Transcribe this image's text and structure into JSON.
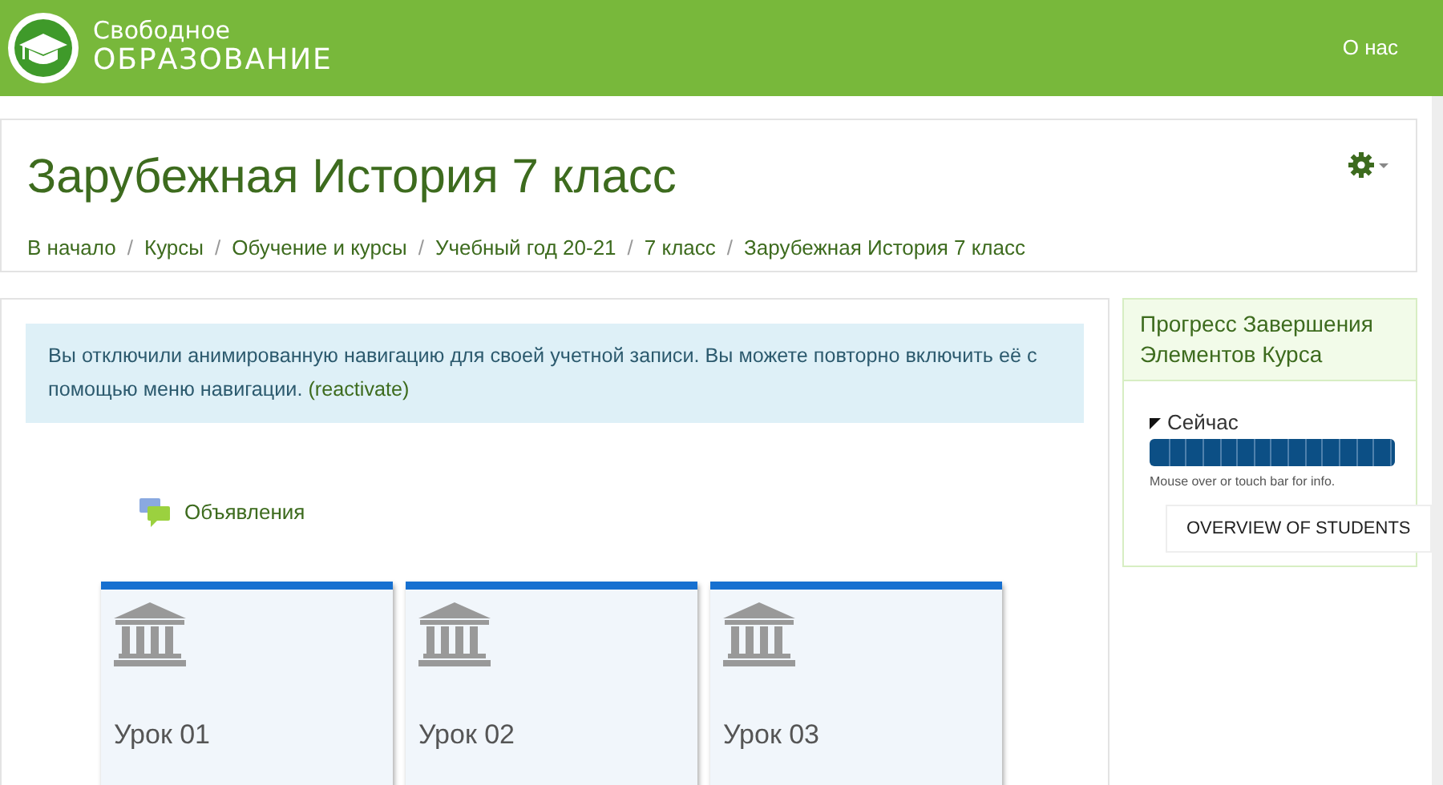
{
  "brand": {
    "line_1": "Свободное",
    "line_2": "ОБРАЗОВАНИЕ"
  },
  "nav_links": [
    "О нас"
  ],
  "page_title": "Зарубежная История 7 класс",
  "breadcrumb_separator": "/",
  "breadcrumbs": [
    "В начало",
    "Курсы",
    "Обучение и курсы",
    "Учебный год 20-21",
    "7 класс",
    "Зарубежная История 7 класс"
  ],
  "notice": {
    "text": "Вы отключили анимированную навигацию для своей учетной записи. Вы можете повторно включить её с помощью меню навигации.",
    "link": "(reactivate)"
  },
  "forum": {
    "label": "Объявления"
  },
  "lessons": [
    {
      "title": "Урок 01"
    },
    {
      "title": "Урок 02"
    },
    {
      "title": "Урок 03"
    }
  ],
  "progress_block": {
    "title": "Прогресс Завершения Элементов Курса",
    "label": "Сейчас",
    "level": 1,
    "hint": "Mouse over or touch bar for info.",
    "button": "OVERVIEW OF STUDENTS"
  }
}
